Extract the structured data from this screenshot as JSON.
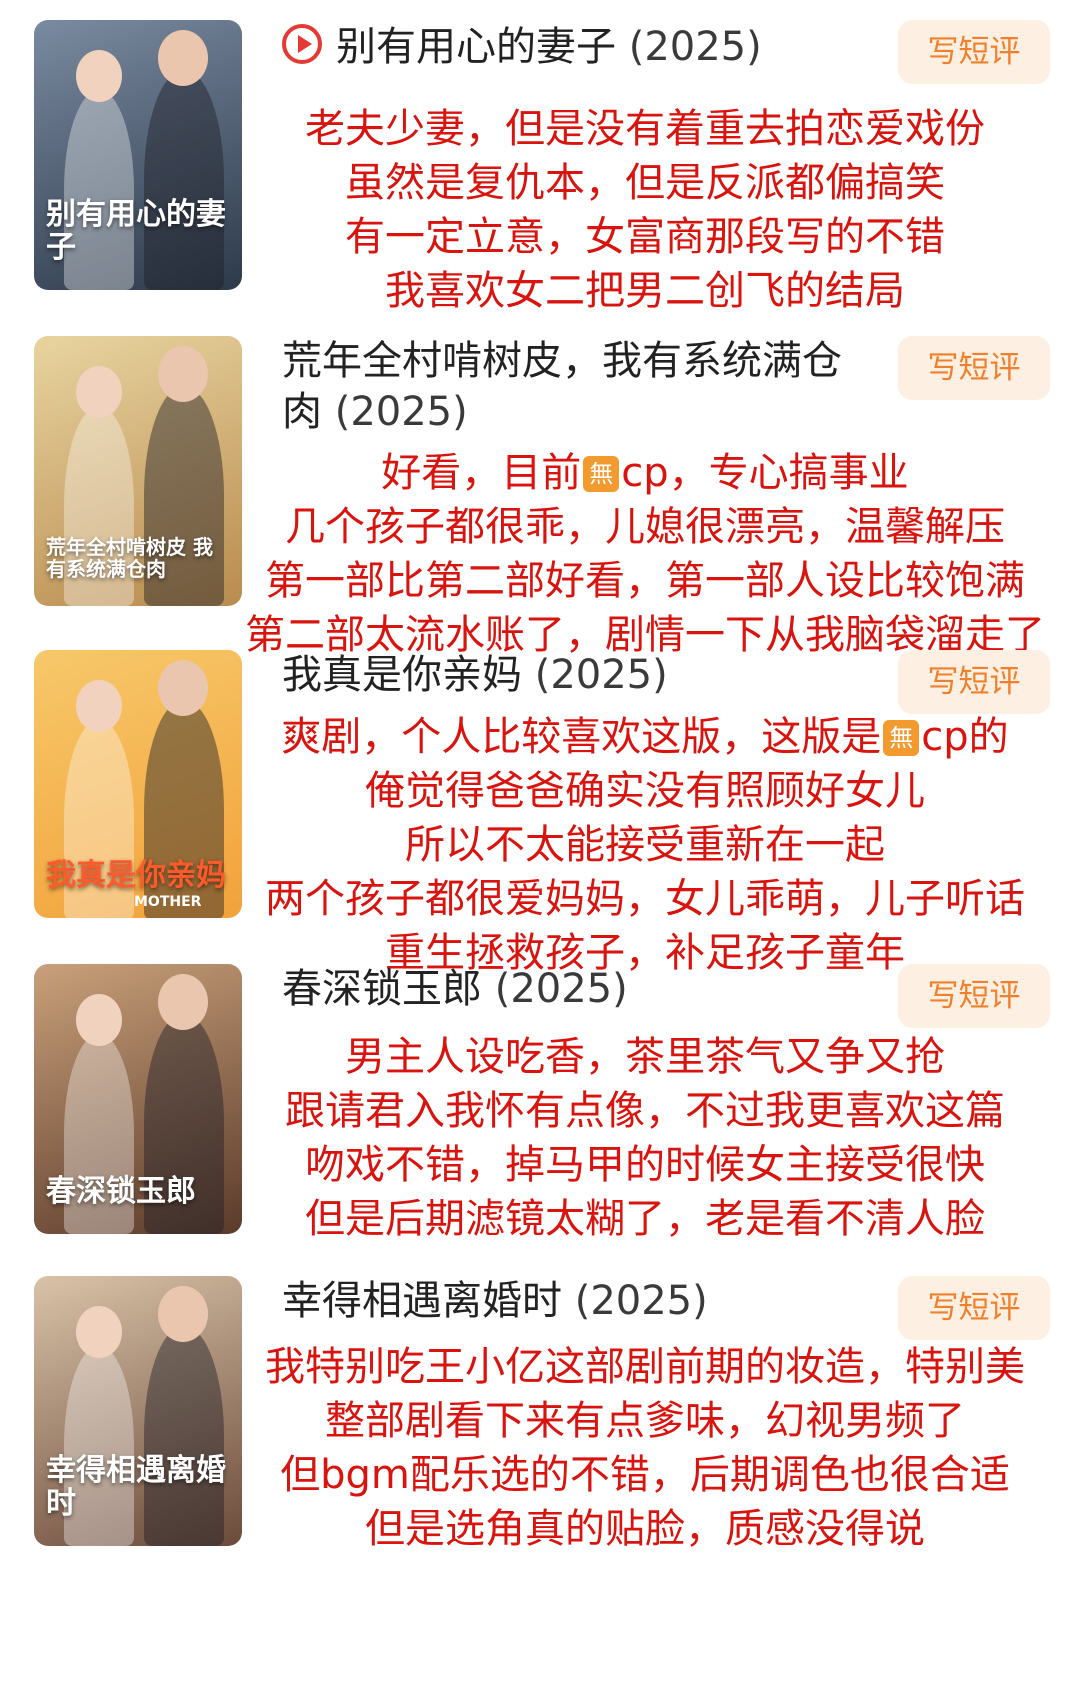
{
  "write_review_label": "写短评",
  "entries": [
    {
      "title": "别有用心的妻子",
      "year": "(2025)",
      "has_play_icon": true,
      "poster_text": "别有用心的妻子",
      "poster_colors": [
        "#2c3a4a",
        "#7a8aa0"
      ],
      "comment_lines": [
        "老夫少妻，但是没有着重去拍恋爱戏份",
        "虽然是复仇本，但是反派都偏搞笑",
        "有一定立意，女富商那段写的不错",
        "我喜欢女二把男二创飞的结局"
      ]
    },
    {
      "title": "荒年全村啃树皮，我有系统满仓肉",
      "year": "(2025)",
      "has_play_icon": false,
      "poster_text": "荒年全村啃树皮 我有系统满仓肉",
      "poster_colors": [
        "#b98b4e",
        "#e8d4a0"
      ],
      "comment_lines": [
        "好看，目前{wu}cp，专心搞事业",
        "几个孩子都很乖，儿媳很漂亮，温馨解压",
        "第一部比第二部好看，第一部人设比较饱满",
        "第二部太流水账了，剧情一下从我脑袋溜走了"
      ]
    },
    {
      "title": "我真是你亲妈",
      "year": "(2025)",
      "has_play_icon": false,
      "poster_text": "我真是你亲妈",
      "poster_sub": "MOTHER",
      "poster_colors": [
        "#f2a23a",
        "#f7c86a"
      ],
      "comment_lines": [
        "爽剧，个人比较喜欢这版，这版是{wu}cp的",
        "俺觉得爸爸确实没有照顾好女儿",
        "所以不太能接受重新在一起",
        "两个孩子都很爱妈妈，女儿乖萌，儿子听话",
        "重生拯救孩子，补足孩子童年"
      ]
    },
    {
      "title": "春深锁玉郎",
      "year": "(2025)",
      "has_play_icon": false,
      "poster_text": "春深锁玉郎",
      "poster_colors": [
        "#5a3a2a",
        "#c9a07a"
      ],
      "comment_lines": [
        "男主人设吃香，茶里茶气又争又抢",
        "跟请君入我怀有点像，不过我更喜欢这篇",
        "吻戏不错，掉马甲的时候女主接受很快",
        "但是后期滤镜太糊了，老是看不清人脸"
      ]
    },
    {
      "title": "幸得相遇离婚时",
      "year": "(2025)",
      "has_play_icon": false,
      "poster_text": "幸得相遇离婚时",
      "poster_colors": [
        "#6b4a3a",
        "#d9c3a8"
      ],
      "comment_lines": [
        "我特别吃王小亿这部剧前期的妆造，特别美",
        "整部剧看下来有点爹味，幻视男频了",
        "但bgm配乐选的不错，后期调色也很合适",
        "但是选角真的贴脸，质感没得说"
      ]
    }
  ],
  "badge_char": "無"
}
